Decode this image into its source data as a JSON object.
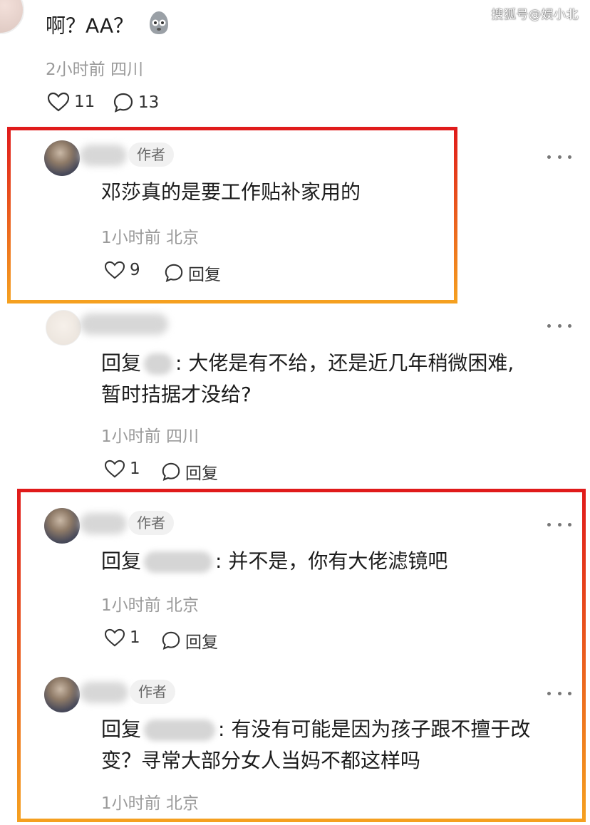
{
  "watermark": "搜狐号@娱小北",
  "top_comment": {
    "text": "啊？AA？",
    "meta": "2小时前 四川",
    "likes": "11",
    "replies": "13"
  },
  "author_badge": "作者",
  "reply_label": "回复",
  "reply1": {
    "text": "邓莎真的是要工作贴补家用的",
    "meta": "1小时前 北京",
    "likes": "9",
    "action": "回复"
  },
  "reply2": {
    "prefix": "回复",
    "line1": ": 大佬是有不给，还是近几年稍微困难,",
    "line2": "暂时拮据才没给?",
    "meta": "1小时前 四川",
    "likes": "1",
    "action": "回复"
  },
  "reply3": {
    "prefix": "回复",
    "text": ": 并不是，你有大佬滤镜吧",
    "meta": "1小时前 北京",
    "likes": "1",
    "action": "回复"
  },
  "reply4": {
    "prefix": "回复",
    "line1": ": 有没有可能是因为孩子跟不擅于改",
    "line2": "变？寻常大部分女人当妈不都这样吗",
    "meta": "1小时前 北京"
  },
  "colors": {
    "frame_top": "#e01b1b",
    "frame_bottom": "#f5a020",
    "meta_gray": "#9a9a9a"
  }
}
